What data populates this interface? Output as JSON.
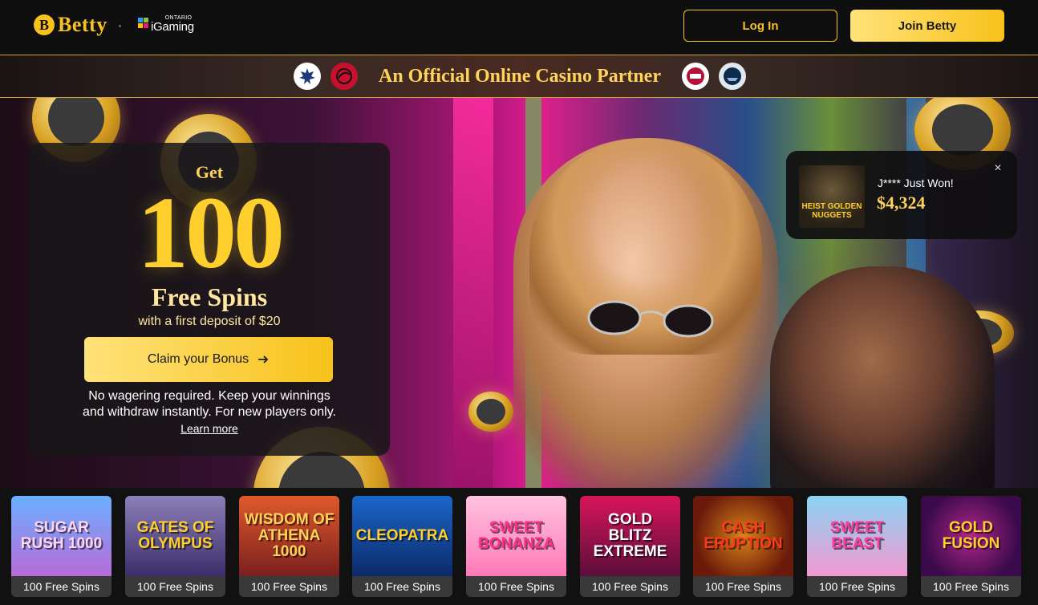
{
  "header": {
    "brand": "Betty",
    "brand_mark": "B",
    "partner_logo_top": "ONTARIO",
    "partner_logo_main": "iGaming",
    "login_label": "Log In",
    "join_label": "Join Betty"
  },
  "partner_banner": {
    "text": "An Official Online Casino Partner",
    "teams": [
      "maple-leafs-icon",
      "raptors-icon",
      "toronto-fc-icon",
      "argonauts-icon"
    ]
  },
  "promo": {
    "get": "Get",
    "amount": "100",
    "spins": "Free Spins",
    "subtitle": "with a first deposit of $20",
    "cta": "Claim your Bonus",
    "note": "No wagering required. Keep your winnings and withdraw instantly. For new players only.",
    "learn_more": "Learn more"
  },
  "win_toast": {
    "game_thumb_text": "HEIST GOLDEN NUGGETS",
    "user": "J**** Just Won!",
    "amount": "$4,324",
    "close": "×"
  },
  "games": [
    {
      "title": "Sugar Rush 1000",
      "caption": "100 Free Spins"
    },
    {
      "title": "Gates of Olympus",
      "caption": "100 Free Spins"
    },
    {
      "title": "Wisdom of Athena 1000",
      "caption": "100 Free Spins"
    },
    {
      "title": "Cleopatra",
      "caption": "100 Free Spins"
    },
    {
      "title": "Sweet Bonanza",
      "caption": "100 Free Spins"
    },
    {
      "title": "Gold Blitz Extreme",
      "caption": "100 Free Spins"
    },
    {
      "title": "Cash Eruption",
      "caption": "100 Free Spins"
    },
    {
      "title": "Sweet Beast",
      "caption": "100 Free Spins"
    },
    {
      "title": "Gold Fusion",
      "caption": "100 Free Spins"
    }
  ],
  "colors": {
    "accent": "#f6c21b",
    "accent_light": "#ffe27a",
    "header_bg": "#0f0f0f"
  }
}
